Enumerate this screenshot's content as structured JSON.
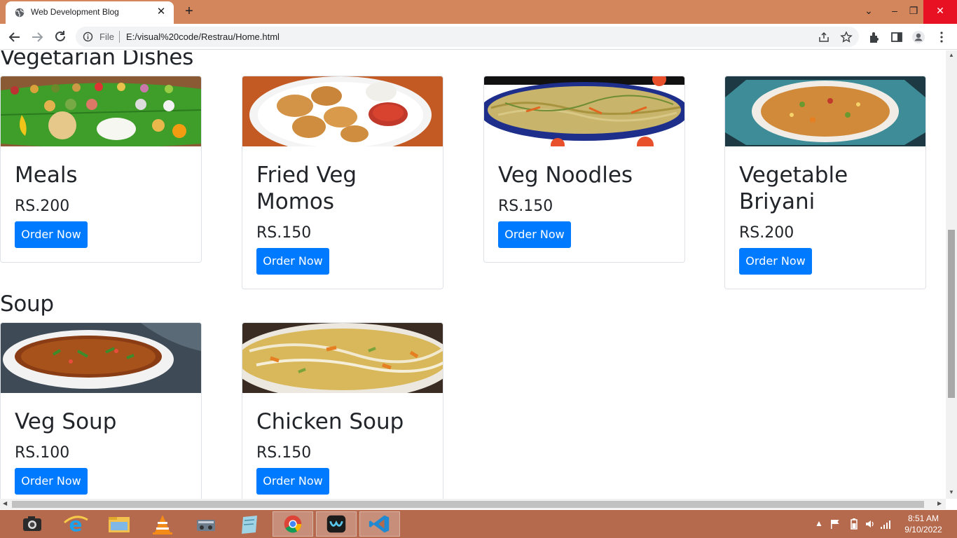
{
  "browser": {
    "tab_title": "Web Development Blog",
    "scheme": "File",
    "url": "E:/visual%20code/Restrau/Home.html"
  },
  "sections": [
    {
      "title": "Vegetarian Dishes",
      "items": [
        {
          "name": "Meals",
          "price": "RS.200",
          "button": "Order Now"
        },
        {
          "name": "Fried Veg Momos",
          "price": "RS.150",
          "button": "Order Now"
        },
        {
          "name": "Veg Noodles",
          "price": "RS.150",
          "button": "Order Now"
        },
        {
          "name": "Vegetable Briyani",
          "price": "RS.200",
          "button": "Order Now"
        }
      ]
    },
    {
      "title": "Soup",
      "items": [
        {
          "name": "Veg Soup",
          "price": "RS.100",
          "button": "Order Now"
        },
        {
          "name": "Chicken Soup",
          "price": "RS.150",
          "button": "Order Now"
        }
      ]
    }
  ],
  "taskbar": {
    "time": "8:51 AM",
    "date": "9/10/2022"
  },
  "colors": {
    "titlebar": "#d3865b",
    "button": "#007bff",
    "taskbar": "#b5694d"
  }
}
